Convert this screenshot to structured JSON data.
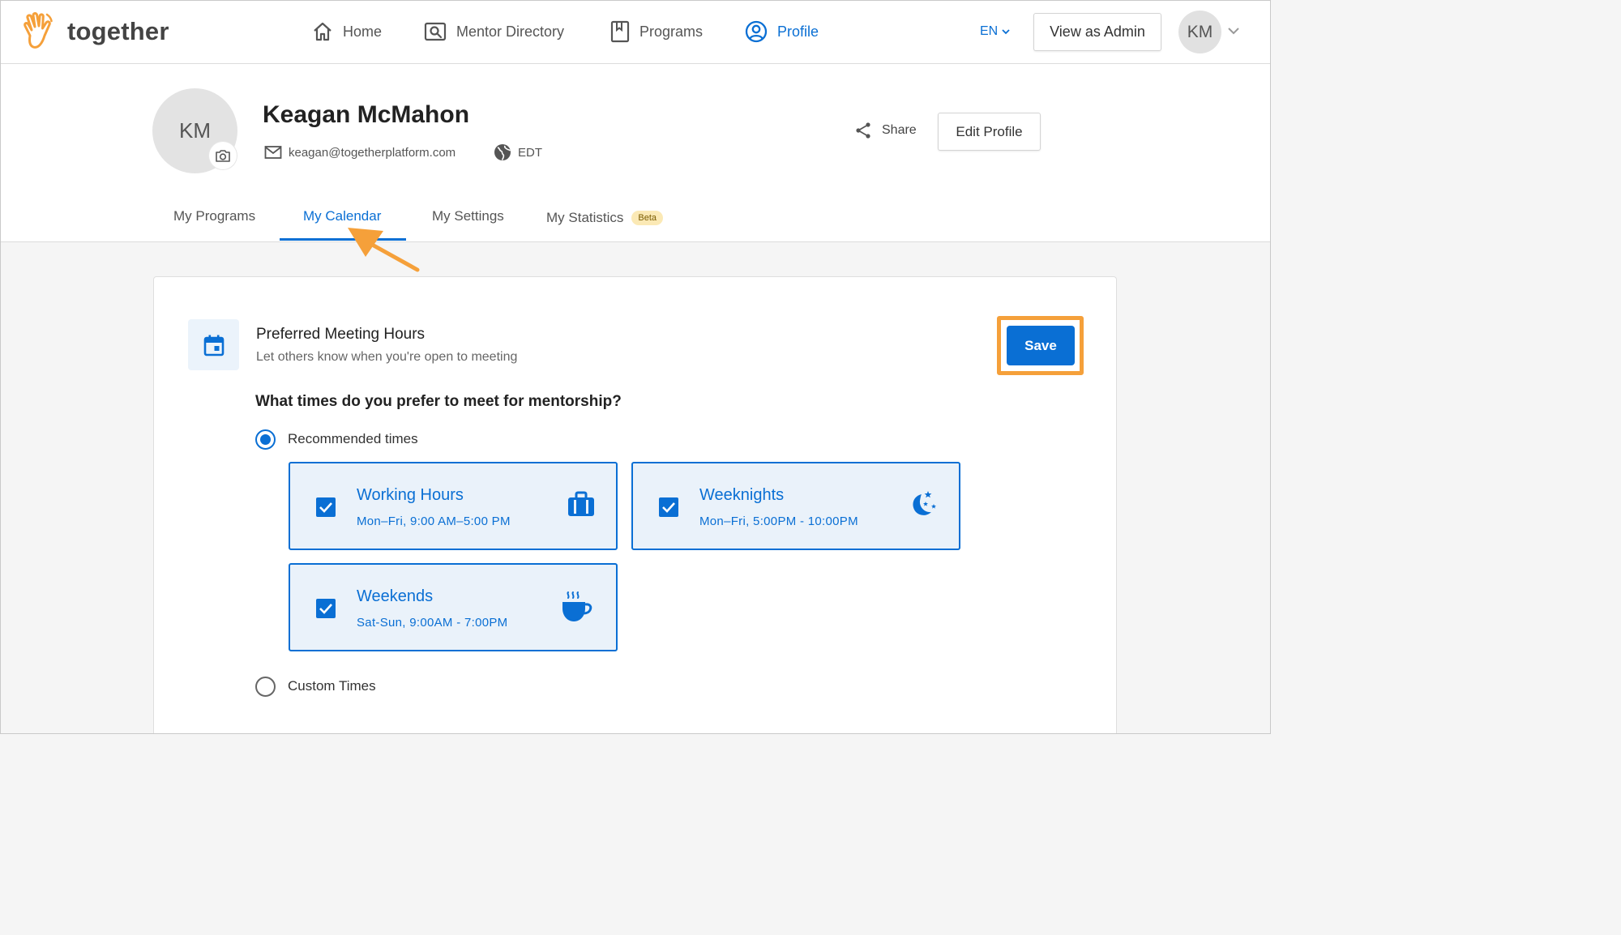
{
  "app": {
    "brand": "together",
    "accent_color": "#0a6fd4",
    "highlight_color": "#f5a03a"
  },
  "nav": {
    "items": [
      {
        "label": "Home",
        "icon": "home-icon"
      },
      {
        "label": "Mentor Directory",
        "icon": "directory-icon"
      },
      {
        "label": "Programs",
        "icon": "bookmark-icon"
      },
      {
        "label": "Profile",
        "icon": "user-circle-icon",
        "active": true
      }
    ],
    "language": "EN",
    "view_as_admin": "View as Admin",
    "user_initials": "KM"
  },
  "profile": {
    "initials": "KM",
    "name": "Keagan McMahon",
    "email": "keagan@togetherplatform.com",
    "timezone": "EDT",
    "share_label": "Share",
    "edit_label": "Edit Profile"
  },
  "tabs": [
    {
      "label": "My Programs"
    },
    {
      "label": "My Calendar",
      "active": true
    },
    {
      "label": "My Settings"
    },
    {
      "label": "My Statistics",
      "badge": "Beta"
    }
  ],
  "calendar": {
    "title": "Preferred Meeting Hours",
    "subtitle": "Let others know when you're open to meeting",
    "save_label": "Save",
    "question": "What times do you prefer to meet for mentorship?",
    "recommended_label": "Recommended times",
    "recommended_selected": true,
    "options": [
      {
        "title": "Working Hours",
        "subtitle": "Mon–Fri, 9:00 AM–5:00 PM",
        "checked": true,
        "icon": "briefcase-icon"
      },
      {
        "title": "Weeknights",
        "subtitle": "Mon–Fri, 5:00PM - 10:00PM",
        "checked": true,
        "icon": "moon-stars-icon"
      },
      {
        "title": "Weekends",
        "subtitle": "Sat-Sun, 9:00AM - 7:00PM",
        "checked": true,
        "icon": "coffee-cup-icon"
      }
    ],
    "custom_label": "Custom Times",
    "custom_selected": false
  }
}
